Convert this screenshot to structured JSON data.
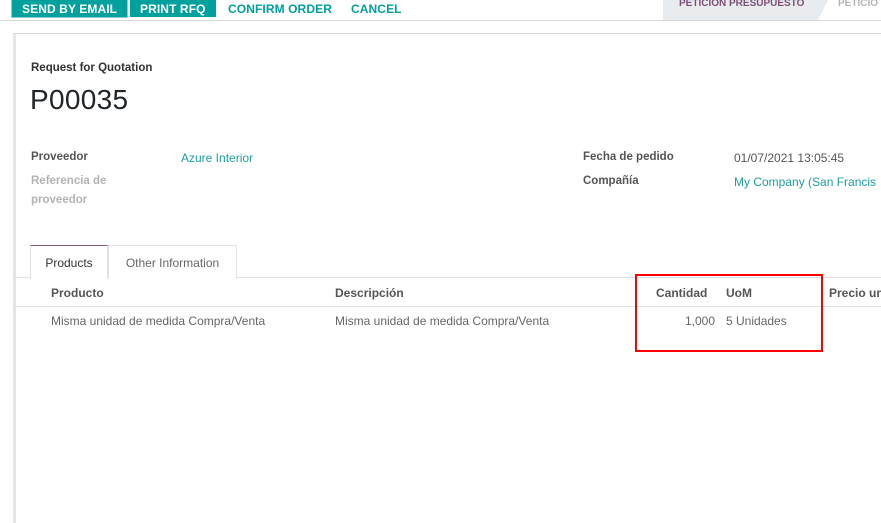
{
  "control_panel": {
    "buttons": [
      {
        "label": "Send by Email",
        "style": "primary"
      },
      {
        "label": "Print RFQ",
        "style": "primary"
      },
      {
        "label": "Confirm Order",
        "style": "link"
      },
      {
        "label": "Cancel",
        "style": "link"
      }
    ],
    "statusbar": {
      "active": "Peticion Presupuesto",
      "next": "Peticio"
    }
  },
  "form": {
    "title_label": "Request for Quotation",
    "title": "P00035",
    "fields_left": [
      {
        "label": "Proveedor",
        "value": "Azure Interior",
        "link": true
      },
      {
        "label": "Referencia de proveedor",
        "value": ""
      }
    ],
    "fields_right": [
      {
        "label": "Fecha de pedido",
        "value": "01/07/2021 13:05:45",
        "link": false
      },
      {
        "label": "Compañía",
        "value": "My Company (San Francis",
        "link": true
      }
    ]
  },
  "tabs": [
    {
      "label": "Products",
      "active": true
    },
    {
      "label": "Other Information",
      "active": false
    }
  ],
  "table": {
    "columns": [
      "Producto",
      "Descripción",
      "Cantidad",
      "UoM",
      "Precio un"
    ],
    "rows": [
      {
        "producto": "Misma unidad de medida Compra/Venta",
        "descripcion": "Misma unidad de medida Compra/Venta",
        "cantidad": "1,000",
        "uom": "5 Unidades"
      }
    ]
  },
  "colors": {
    "primary": "#00a09d",
    "brand": "#875a7b",
    "highlight": "#ff0000"
  }
}
